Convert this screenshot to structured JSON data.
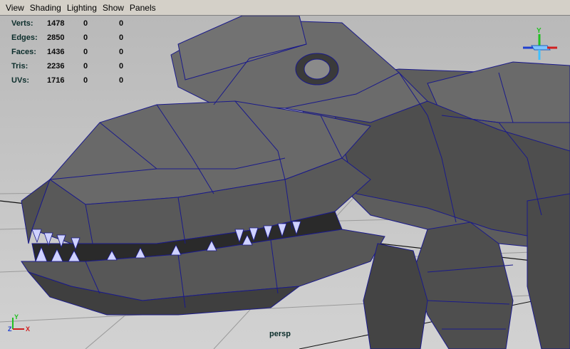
{
  "menu": {
    "items": [
      "View",
      "Shading",
      "Lighting",
      "Show",
      "Panels"
    ]
  },
  "hud": {
    "rows": [
      {
        "label": "Verts:",
        "values": [
          "1478",
          "0",
          "0"
        ]
      },
      {
        "label": "Edges:",
        "values": [
          "2850",
          "0",
          "0"
        ]
      },
      {
        "label": "Faces:",
        "values": [
          "1436",
          "0",
          "0"
        ]
      },
      {
        "label": "Tris:",
        "values": [
          "2236",
          "0",
          "0"
        ]
      },
      {
        "label": "UVs:",
        "values": [
          "1716",
          "0",
          "0"
        ]
      }
    ]
  },
  "viewport": {
    "camera_name": "persp",
    "axis_labels": {
      "y": "Y",
      "x": "X",
      "z": "Z"
    }
  },
  "colors": {
    "wireframe": "#1a1a8a",
    "mesh_fill": "#5b5b5b",
    "background": "#c8c8c8",
    "axis_x": "#d02020",
    "axis_y": "#20c020",
    "axis_z": "#2040d0"
  }
}
